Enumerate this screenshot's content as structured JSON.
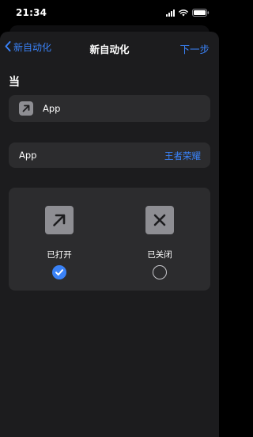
{
  "status_bar": {
    "time": "21:34"
  },
  "nav": {
    "back_label": "新自动化",
    "title": "新自动化",
    "next_label": "下一步"
  },
  "section": {
    "heading": "当"
  },
  "trigger": {
    "label": "App",
    "icon": "arrow-up-right-icon"
  },
  "app_row": {
    "label": "App",
    "value": "王者荣耀"
  },
  "options": {
    "opened": {
      "label": "已打开",
      "icon": "arrow-up-right-icon",
      "selected": true
    },
    "closed": {
      "label": "已关闭",
      "icon": "close-x-icon",
      "selected": false
    }
  },
  "colors": {
    "accent": "#3a82f7",
    "sheet_background": "#1c1c1e",
    "cell_background": "#2c2c2e",
    "icon_tile": "#8e8e93"
  }
}
